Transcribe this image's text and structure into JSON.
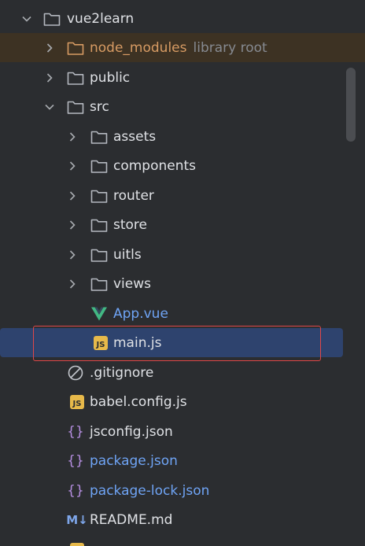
{
  "project_tree": {
    "root": {
      "label": "vue2learn"
    },
    "node_modules": {
      "label": "node_modules",
      "hint": "library root"
    },
    "public": {
      "label": "public"
    },
    "src": {
      "label": "src"
    },
    "assets": {
      "label": "assets"
    },
    "components": {
      "label": "components"
    },
    "router": {
      "label": "router"
    },
    "store": {
      "label": "store"
    },
    "uitls": {
      "label": "uitls"
    },
    "views": {
      "label": "views"
    },
    "app_vue": {
      "label": "App.vue"
    },
    "main_js": {
      "label": "main.js"
    },
    "gitignore": {
      "label": ".gitignore"
    },
    "babel_config": {
      "label": "babel.config.js"
    },
    "jsconfig": {
      "label": "jsconfig.json"
    },
    "package_json": {
      "label": "package.json"
    },
    "package_lock": {
      "label": "package-lock.json"
    },
    "readme": {
      "label": "README.md",
      "badge": "M↓"
    },
    "js_badge_text": "JS",
    "json_badge_text": "{}"
  },
  "colors": {
    "background": "#2b2d30",
    "text": "#dfe1e5",
    "excluded_text": "#d79b63",
    "modified_text": "#6fa4f5",
    "selection": "#2e436e",
    "highlight_border": "#e04848",
    "js_badge": "#e7b94a",
    "vue_logo": "#42b883",
    "json_icon": "#b58ee0"
  }
}
